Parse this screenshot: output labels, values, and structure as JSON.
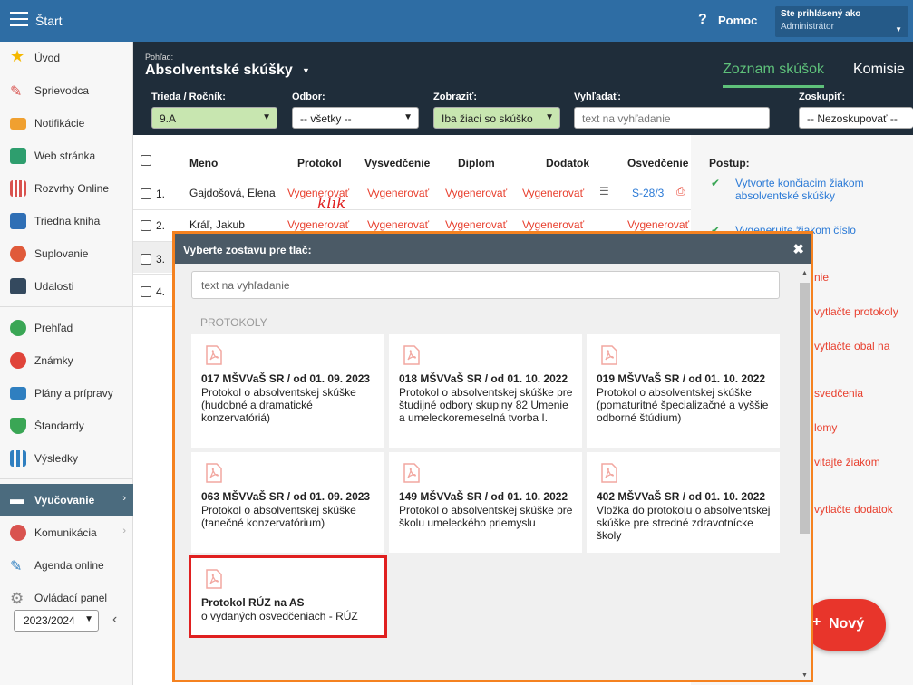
{
  "topbar": {
    "title": "Štart",
    "help_label": "Pomoc",
    "login_label": "Ste prihlásený ako",
    "login_user": "Administrátor"
  },
  "sidebar": {
    "items": [
      {
        "label": "Úvod"
      },
      {
        "label": "Sprievodca"
      },
      {
        "label": "Notifikácie"
      },
      {
        "label": "Web stránka"
      },
      {
        "label": "Rozvrhy Online"
      },
      {
        "label": "Triedna kniha"
      },
      {
        "label": "Suplovanie"
      },
      {
        "label": "Udalosti"
      },
      {
        "label": "Prehľad"
      },
      {
        "label": "Známky"
      },
      {
        "label": "Plány a prípravy"
      },
      {
        "label": "Štandardy"
      },
      {
        "label": "Výsledky"
      },
      {
        "label": "Vyučovanie"
      },
      {
        "label": "Komunikácia"
      },
      {
        "label": "Agenda online"
      },
      {
        "label": "Ovládací panel"
      }
    ],
    "year": "2023/2024"
  },
  "header": {
    "view_label": "Pohľad:",
    "view_value": "Absolventské skúšky",
    "tab_active": "Zoznam skúšok",
    "tab_other": "Komisie",
    "filters": {
      "class_label": "Trieda / Ročník:",
      "class_value": "9.A",
      "field_label": "Odbor:",
      "field_value": "-- všetky --",
      "show_label": "Zobraziť:",
      "show_value": "Iba žiaci so skúško",
      "search_label": "Vyhľadať:",
      "search_placeholder": "text na vyhľadanie",
      "group_label": "Zoskupiť:",
      "group_value": "-- Nezoskupovať --"
    }
  },
  "table": {
    "columns": [
      "Meno",
      "Protokol",
      "Vysvedčenie",
      "Diplom",
      "Dodatok",
      "Osvedčenie"
    ],
    "rows": [
      {
        "num": "1.",
        "name": "Gajdošová, Elena",
        "protokol": "Vygenerovať",
        "vysvedcenie": "Vygenerovať",
        "diplom": "Vygenerovať",
        "dodatok": "Vygenerovať",
        "osvedcenie": "S-28/3"
      },
      {
        "num": "2.",
        "name": "Kráľ, Jakub",
        "protokol": "Vygenerovať",
        "vysvedcenie": "Vygenerovať",
        "diplom": "Vygenerovať",
        "dodatok": "Vygenerovať",
        "osvedcenie": "Vygenerovať"
      },
      {
        "num": "3."
      },
      {
        "num": "4."
      }
    ]
  },
  "annotation": "klik",
  "right": {
    "postup": "Postup:",
    "steps": [
      "Vytvorte končiacim žiakom absolventské skúšky",
      "Vygenerujte žiakom číslo",
      "nie",
      "vytlačte protokoly",
      "vytlačte obal na",
      "svedčenia",
      "lomy",
      "vitajte žiakom",
      "vytlačte dodatok"
    ],
    "new_button": "Nový",
    "new_plus": "+"
  },
  "modal": {
    "title": "Vyberte zostavu pre tlač:",
    "close": "✖",
    "search_placeholder": "text na vyhľadanie",
    "section": "PROTOKOLY",
    "cards": [
      {
        "title": "017 MŠVVaŠ SR / od 01. 09. 2023",
        "desc": "Protokol o absolventskej skúške (hudobné a dramatické konzervatóriá)"
      },
      {
        "title": "018 MŠVVaŠ SR / od 01. 10. 2022",
        "desc": "Protokol o absolventskej skúške pre študijné odbory skupiny 82 Umenie a umeleckoremeselná tvorba I."
      },
      {
        "title": "019 MŠVVaŠ SR / od 01. 10. 2022",
        "desc": "Protokol o absolventskej skúške (pomaturitné špecializačné a vyššie odborné štúdium)"
      },
      {
        "title": "063 MŠVVaŠ SR / od 01. 09. 2023",
        "desc": "Protokol o absolventskej skúške (tanečné konzervatórium)"
      },
      {
        "title": "149 MŠVVaŠ SR / od 01. 10. 2022",
        "desc": "Protokol o absolventskej skúške pre školu umeleckého priemyslu"
      },
      {
        "title": "402 MŠVVaŠ SR / od 01. 10. 2022",
        "desc": "Vložka do protokolu o absolventskej skúške pre stredné zdravotnícke školy"
      },
      {
        "title": "Protokol RÚZ na AS",
        "desc": "o vydaných osvedčeniach - RÚZ"
      }
    ]
  },
  "colors": {
    "topbar": "#2e6da4",
    "header": "#1f2d3a",
    "accent_green": "#5ec17a",
    "link_red": "#e8402f",
    "modal_border": "#f58220",
    "highlight": "#e02020"
  }
}
